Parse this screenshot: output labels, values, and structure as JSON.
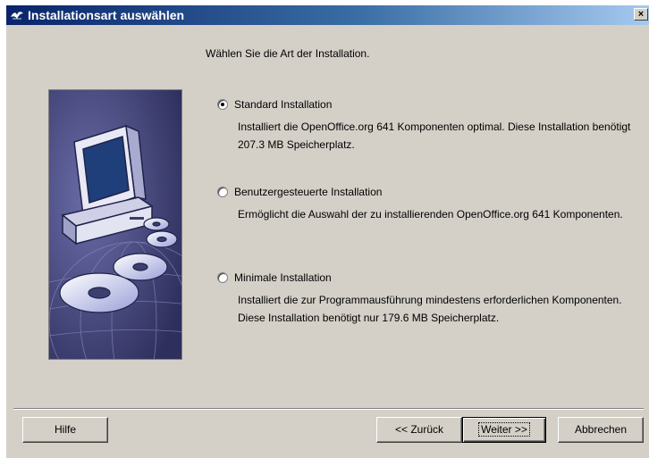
{
  "window": {
    "title": "Installationsart auswählen",
    "close_glyph": "×"
  },
  "heading": "Wählen Sie die Art der Installation.",
  "options": [
    {
      "label": "Standard Installation",
      "description": "Installiert die OpenOffice.org 641 Komponenten optimal. Diese Installation benötigt 207.3 MB Speicherplatz.",
      "selected": true
    },
    {
      "label": "Benutzergesteuerte Installation",
      "description": "Ermöglicht die Auswahl der zu installierenden OpenOffice.org 641 Komponenten.",
      "selected": false
    },
    {
      "label": "Minimale Installation",
      "description": "Installiert die zur Programmausführung mindestens erforderlichen Komponenten. Diese Installation benötigt nur 179.6 MB Speicherplatz.",
      "selected": false
    }
  ],
  "buttons": {
    "help": "Hilfe",
    "back": "<< Zurück",
    "next": "Weiter >>",
    "cancel": "Abbrechen"
  },
  "icons": {
    "title": "openoffice-gull-icon",
    "illustration": "computer-with-discs-illustration"
  },
  "colors": {
    "titlebar_start": "#0a246a",
    "titlebar_end": "#a6caf0",
    "dialog_bg": "#d4d0c8",
    "illustration_bg": "#3d3f70"
  }
}
